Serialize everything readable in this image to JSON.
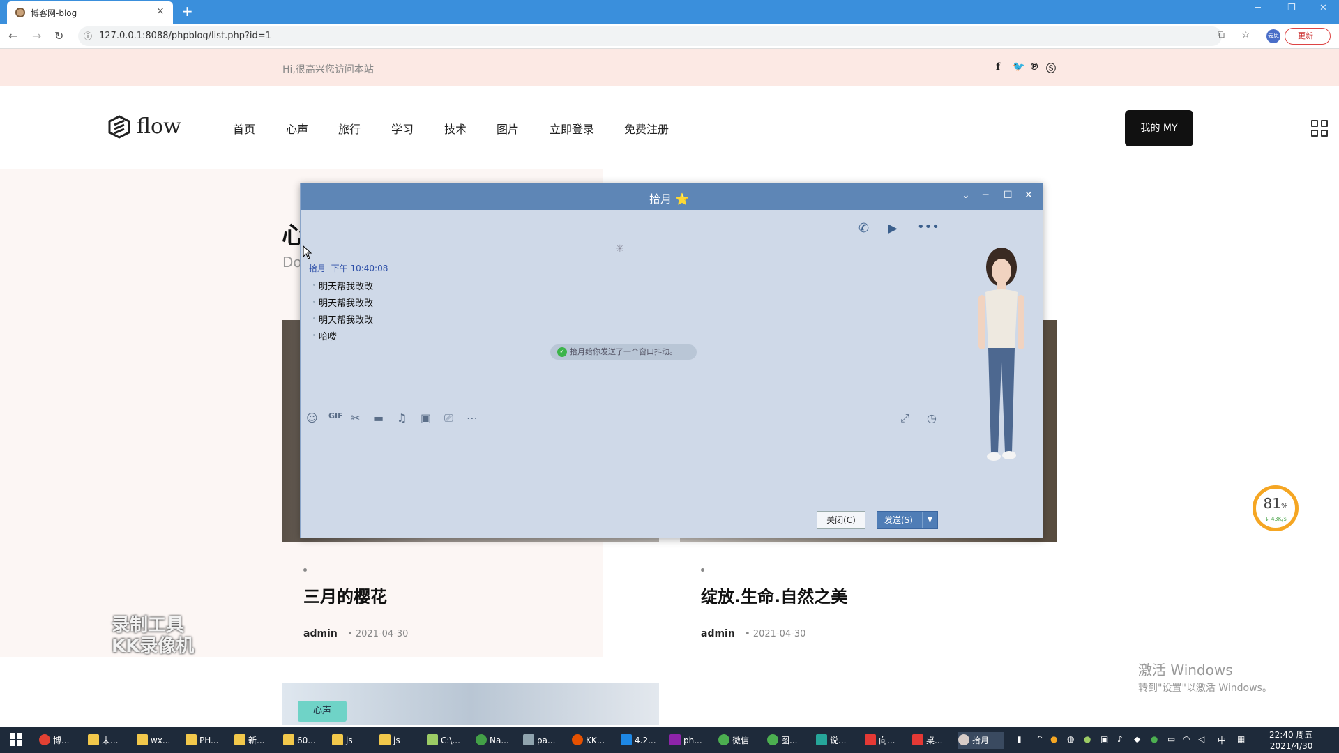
{
  "browser": {
    "tab_title": "博客网-blog",
    "tab_close": "×",
    "new_tab": "+",
    "url": "127.0.0.1:8088/phpblog/list.php?id=1",
    "update_label": "更新",
    "profile_label": "云思"
  },
  "site": {
    "greeting": "Hi,很高兴您访问本站",
    "logo_text": "flow",
    "nav": [
      "首页",
      "心声",
      "旅行",
      "学习",
      "技术",
      "图片",
      "立即登录",
      "免费注册"
    ],
    "my_button": "我的 MY",
    "heading": "心",
    "subheading": "Do",
    "cards": [
      {
        "title": "三月的樱花",
        "author": "admin",
        "date": "2021-04-30"
      },
      {
        "title": "绽放.生命.自然之美",
        "author": "admin",
        "date": "2021-04-30"
      }
    ],
    "tag_label": "心声"
  },
  "overlay": {
    "watermark_line1": "录制工具",
    "watermark_line2": "KK录像机",
    "activate_line1": "激活 Windows",
    "activate_line2": "转到\"设置\"以激活 Windows。",
    "speed_percent": "81",
    "speed_percent_unit": "%",
    "speed_rate": "↓ 43K/s"
  },
  "chat": {
    "title": "拾月",
    "title_star": "⭐",
    "message_sender": "拾月",
    "message_time": "下午 10:40:08",
    "messages": [
      "明天帮我改改",
      "明天帮我改改",
      "明天帮我改改",
      "哈喽"
    ],
    "system_note": "拾月给你发送了一个窗口抖动。",
    "close_button": "关闭(C)",
    "send_button": "发送(S)"
  },
  "taskbar": {
    "items": [
      "博...",
      "未...",
      "wx...",
      "PH...",
      "新...",
      "60...",
      "js",
      "js",
      "C:\\...",
      "Na...",
      "pa...",
      "KK...",
      "4.2...",
      "ph...",
      "微信",
      "图...",
      "说...",
      "向...",
      "桌...",
      "拾月"
    ],
    "ime": "中",
    "time": "22:40 周五",
    "date": "2021/4/30"
  }
}
